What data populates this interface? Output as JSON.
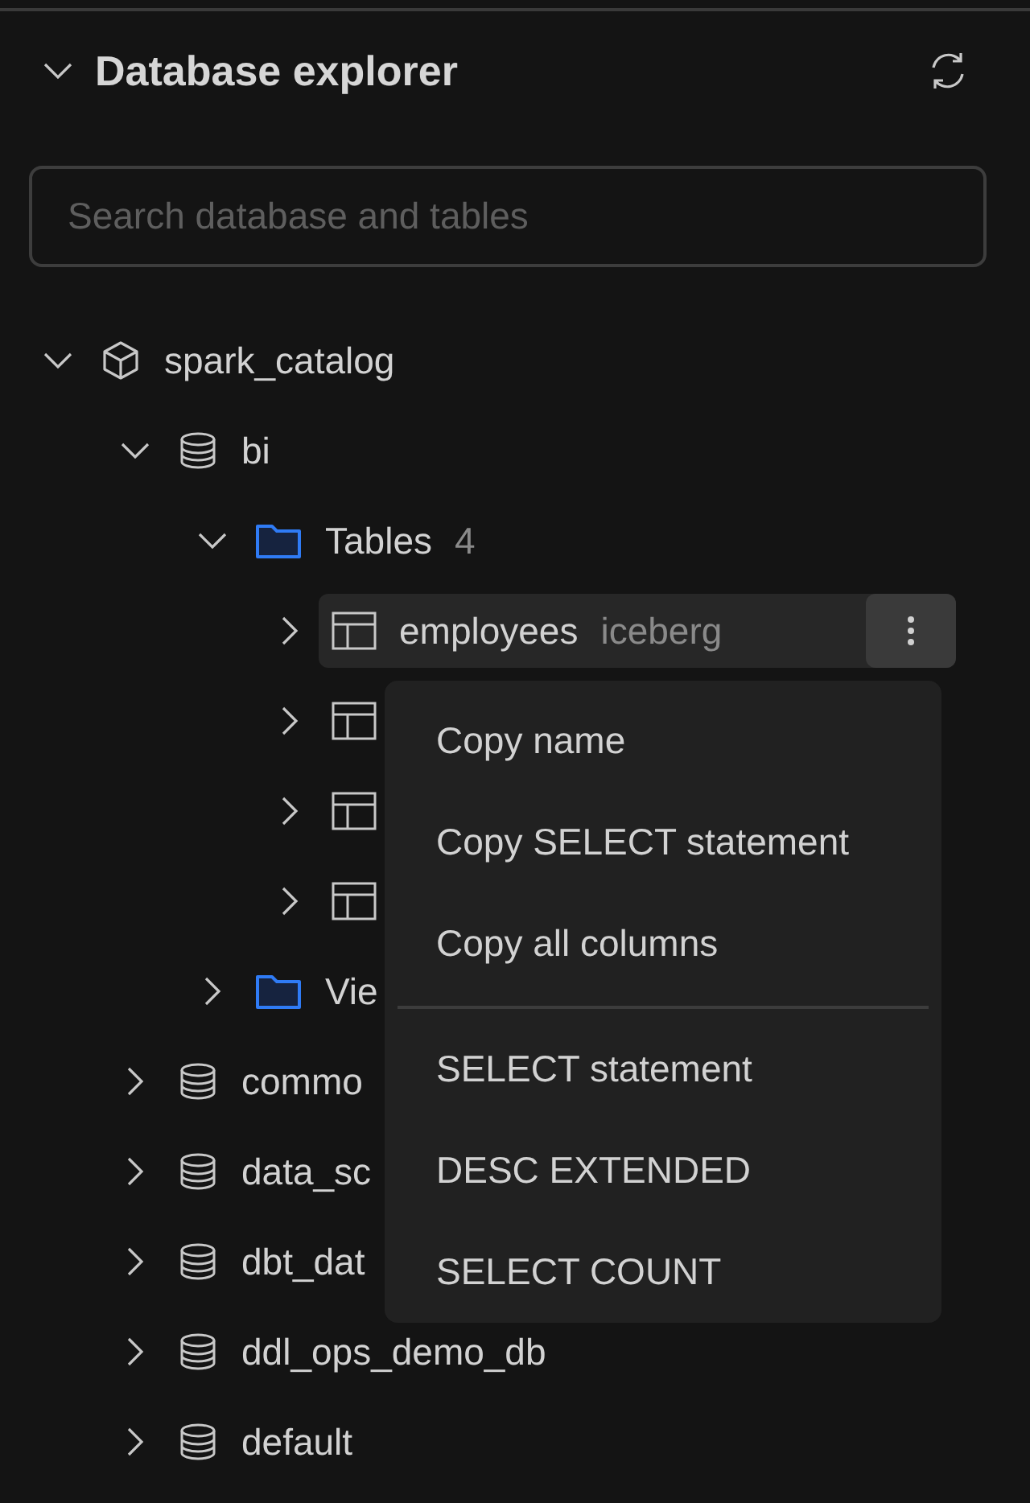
{
  "panel": {
    "title": "Database explorer",
    "expanded": true
  },
  "search": {
    "placeholder": "Search database and tables"
  },
  "tree": [
    {
      "name": "spark_catalog",
      "kind": "catalog",
      "expanded": true,
      "children": [
        {
          "name": "bi",
          "kind": "database",
          "expanded": true,
          "children": [
            {
              "name": "Tables",
              "kind": "folder",
              "count": "4",
              "expanded": true,
              "children": [
                {
                  "name": "employees",
                  "kind": "table",
                  "tag": "iceberg",
                  "expanded": false,
                  "selected": true
                },
                {
                  "kind": "table",
                  "expanded": false,
                  "selected": false
                },
                {
                  "kind": "table",
                  "expanded": false,
                  "selected": false
                },
                {
                  "kind": "table",
                  "expanded": false,
                  "selected": false
                }
              ]
            },
            {
              "name": "Vie",
              "kind": "folder",
              "expanded": false
            }
          ]
        },
        {
          "name": "commo",
          "kind": "database",
          "expanded": false
        },
        {
          "name": "data_sc",
          "kind": "database",
          "expanded": false
        },
        {
          "name": "dbt_dat",
          "kind": "database",
          "expanded": false
        },
        {
          "name": "ddl_ops_demo_db",
          "kind": "database",
          "expanded": false
        },
        {
          "name": "default",
          "kind": "database",
          "expanded": false
        }
      ]
    }
  ],
  "context_menu": {
    "groups": [
      [
        "Copy name",
        "Copy SELECT statement",
        "Copy all columns"
      ],
      [
        "SELECT statement",
        "DESC EXTENDED",
        "SELECT COUNT"
      ]
    ]
  }
}
